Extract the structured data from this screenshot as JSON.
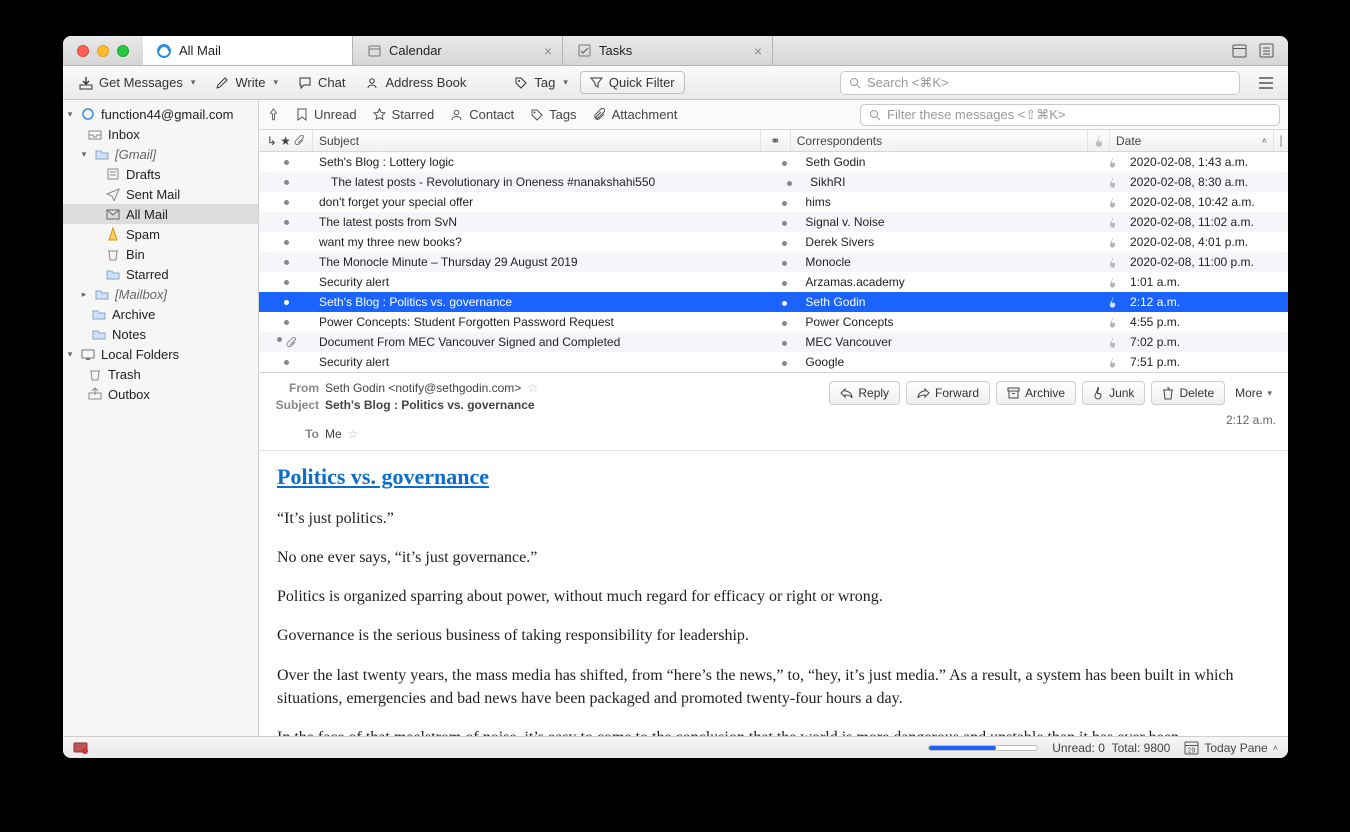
{
  "tabs": [
    {
      "label": "All Mail",
      "icon": "mail"
    },
    {
      "label": "Calendar",
      "icon": "calendar"
    },
    {
      "label": "Tasks",
      "icon": "tasks"
    }
  ],
  "toolbar": {
    "get_messages": "Get Messages",
    "write": "Write",
    "chat": "Chat",
    "address_book": "Address Book",
    "tag": "Tag",
    "quick_filter": "Quick Filter",
    "search_placeholder": "Search <⌘K>"
  },
  "sidebar": {
    "account": "function44@gmail.com",
    "inbox": "Inbox",
    "gmail": "[Gmail]",
    "drafts": "Drafts",
    "sent": "Sent Mail",
    "all_mail": "All Mail",
    "spam": "Spam",
    "bin": "Bin",
    "starred": "Starred",
    "mailbox": "[Mailbox]",
    "archive": "Archive",
    "notes": "Notes",
    "local": "Local Folders",
    "trash": "Trash",
    "outbox": "Outbox"
  },
  "filterbar": {
    "unread": "Unread",
    "starred": "Starred",
    "contact": "Contact",
    "tags": "Tags",
    "attachment": "Attachment",
    "filter_placeholder": "Filter these messages <⇧⌘K>"
  },
  "columns": {
    "subject": "Subject",
    "correspondents": "Correspondents",
    "date": "Date"
  },
  "messages": [
    {
      "subject": "Seth's Blog : Lottery logic",
      "corr": "Seth Godin",
      "date": "2020-02-08, 1:43 a.m.",
      "attach": false,
      "indent": false
    },
    {
      "subject": "The latest posts - Revolutionary in Oneness #nanakshahi550",
      "corr": "SikhRI",
      "date": "2020-02-08, 8:30 a.m.",
      "attach": false,
      "indent": true
    },
    {
      "subject": "don't forget your special offer",
      "corr": "hims",
      "date": "2020-02-08, 10:42 a.m.",
      "attach": false,
      "indent": false
    },
    {
      "subject": "The latest posts from SvN",
      "corr": "Signal v. Noise",
      "date": "2020-02-08, 11:02 a.m.",
      "attach": false,
      "indent": false
    },
    {
      "subject": "want my three new books?",
      "corr": "Derek Sivers",
      "date": "2020-02-08, 4:01 p.m.",
      "attach": false,
      "indent": false
    },
    {
      "subject": "The Monocle Minute – Thursday 29 August 2019",
      "corr": "Monocle",
      "date": "2020-02-08, 11:00 p.m.",
      "attach": false,
      "indent": false
    },
    {
      "subject": "Security alert",
      "corr": "Arzamas.academy",
      "date": "1:01 a.m.",
      "attach": false,
      "indent": false
    },
    {
      "subject": "Seth's Blog : Politics vs. governance",
      "corr": "Seth Godin",
      "date": "2:12 a.m.",
      "attach": false,
      "indent": false,
      "selected": true
    },
    {
      "subject": "Power Concepts: Student Forgotten Password Request",
      "corr": "Power Concepts",
      "date": "4:55 p.m.",
      "attach": false,
      "indent": false
    },
    {
      "subject": "Document From MEC Vancouver Signed and Completed",
      "corr": "MEC Vancouver",
      "date": "7:02 p.m.",
      "attach": true,
      "indent": false
    },
    {
      "subject": "Security alert",
      "corr": "Google",
      "date": "7:51 p.m.",
      "attach": false,
      "indent": false
    }
  ],
  "preview": {
    "from_label": "From",
    "from_value": "Seth Godin <notify@sethgodin.com>",
    "subject_label": "Subject",
    "subject_value": "Seth's Blog : Politics vs. governance",
    "to_label": "To",
    "to_value": "Me",
    "time": "2:12 a.m.",
    "actions": {
      "reply": "Reply",
      "forward": "Forward",
      "archive": "Archive",
      "junk": "Junk",
      "delete": "Delete",
      "more": "More"
    },
    "title": "Politics vs. governance",
    "body": [
      "“It’s just politics.”",
      "No one ever says, “it’s just governance.”",
      "Politics is organized sparring about power, without much regard for efficacy or right or wrong.",
      "Governance is the serious business of taking responsibility for leadership.",
      "Over the last twenty years, the mass media has shifted, from “here’s the news,” to, “hey, it’s just media.” As a result, a system has been built in which situations, emergencies and bad news have been packaged and promoted twenty-four hours a day.",
      "In the face of that maelstrom of noise, it’s easy to come to the conclusion that the world is more dangerous and unstable than it has ever been."
    ]
  },
  "status": {
    "unread": "Unread: 0",
    "total": "Total: 9800",
    "today_pane": "Today Pane"
  }
}
